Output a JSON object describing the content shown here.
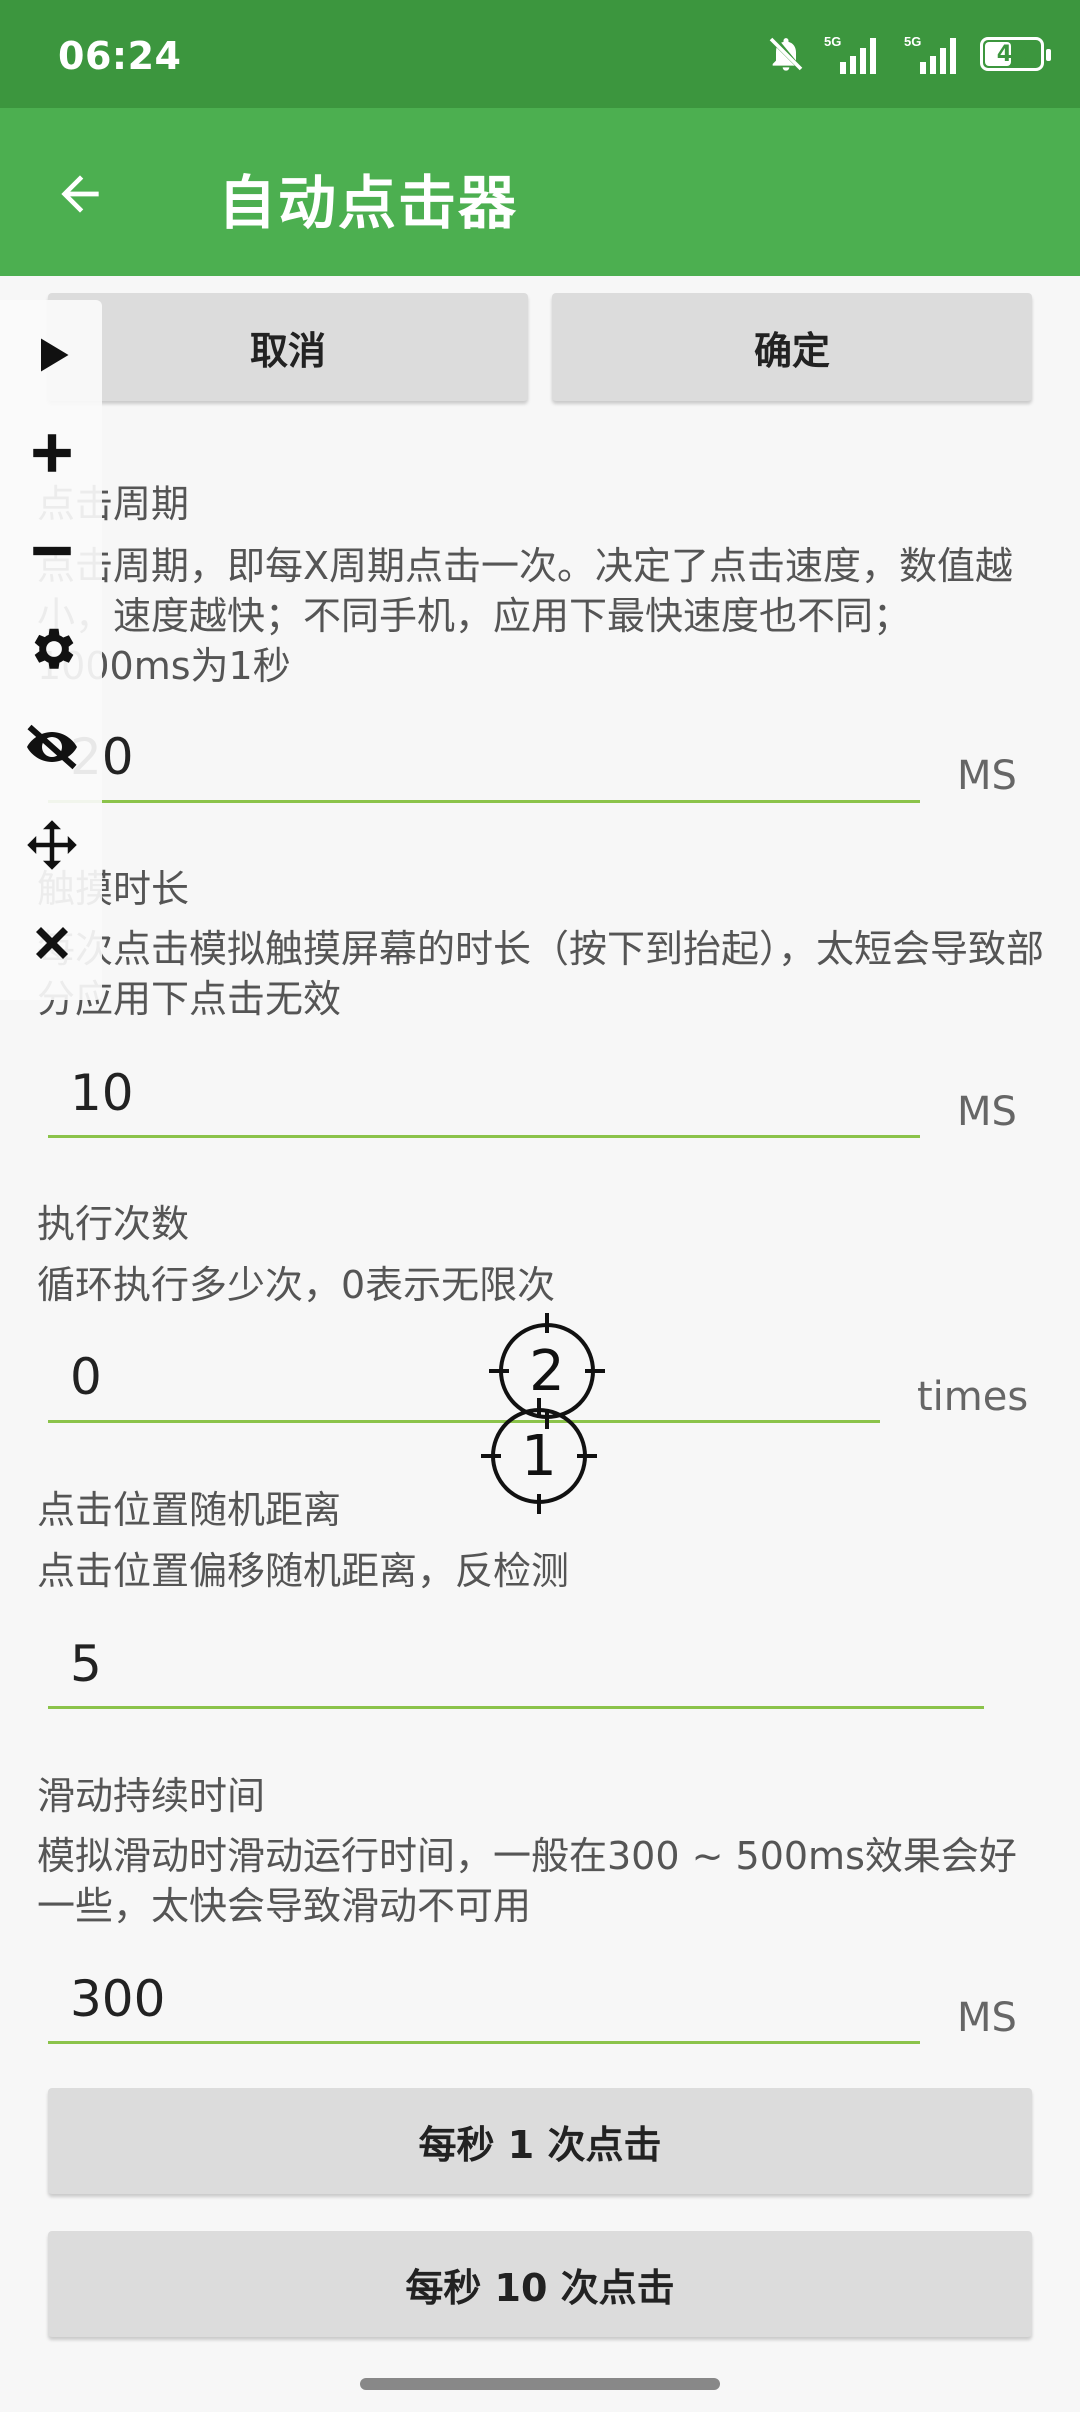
{
  "status_bar": {
    "time": "06:24",
    "icons": [
      "bell-off-icon",
      "signal-5g-icon",
      "signal-5g-icon",
      "battery-icon"
    ],
    "network_label_1": "5G",
    "network_label_2": "5G",
    "battery_level": "46"
  },
  "app_bar": {
    "title": "自动点击器",
    "back_icon": "arrow-left-icon"
  },
  "actions": {
    "cancel_label": "取消",
    "confirm_label": "确定"
  },
  "settings": [
    {
      "label": "点击周期",
      "description": "点击周期，即每X周期点击一次。决定了点击速度，数值越小，速度越快；不同手机，应用下最快速度也不同；1000ms为1秒",
      "value": "20",
      "unit": "MS"
    },
    {
      "label": "触摸时长",
      "description": "每次点击模拟触摸屏幕的时长（按下到抬起），太短会导致部分应用下点击无效",
      "value": "10",
      "unit": "MS"
    },
    {
      "label": "执行次数",
      "description": "循环执行多少次，0表示无限次",
      "value": "0",
      "unit": "times"
    },
    {
      "label": "点击位置随机距离",
      "description": "点击位置偏移随机距离，反检测",
      "value": "5",
      "unit": ""
    },
    {
      "label": "滑动持续时间",
      "description": "模拟滑动时滑动运行时间，一般在300 ~ 500ms效果会好一些，太快会导致滑动不可用",
      "value": "300",
      "unit": "MS"
    }
  ],
  "presets": {
    "one_per_second": "每秒 1 次点击",
    "ten_per_second": "每秒 10 次点击"
  },
  "floating_toolbar": {
    "items": [
      "play-icon",
      "plus-icon",
      "minus-icon",
      "gear-icon",
      "eye-off-icon",
      "move-icon",
      "close-icon"
    ]
  },
  "targets": [
    {
      "number": "2"
    },
    {
      "number": "1"
    }
  ],
  "colors": {
    "status_bar": "#3c963e",
    "app_bar": "#4caf50",
    "input_underline": "#8bc34a",
    "button_bg": "#dcdcdc"
  }
}
